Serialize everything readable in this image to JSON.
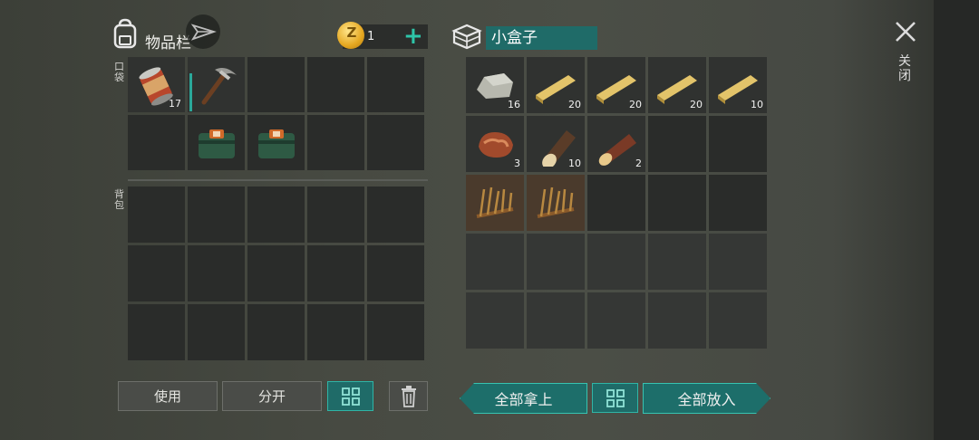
{
  "header": {
    "inventory_title": "物品栏",
    "coin_symbol": "Z",
    "coin_count": "1",
    "add_symbol": "+",
    "container_name": "小盒子",
    "close_label": "关闭"
  },
  "sections": {
    "pocket": "口袋",
    "backpack": "背包"
  },
  "pocket_slots": [
    {
      "item": "canned-food-icon",
      "count": "17"
    },
    {
      "item": "pickaxe-icon",
      "count": "",
      "durability": true
    },
    {
      "item": "",
      "count": ""
    },
    {
      "item": "",
      "count": ""
    },
    {
      "item": "",
      "count": ""
    },
    {
      "item": "",
      "count": ""
    },
    {
      "item": "medkit-icon",
      "count": ""
    },
    {
      "item": "medkit-icon",
      "count": ""
    },
    {
      "item": "",
      "count": ""
    },
    {
      "item": "",
      "count": ""
    }
  ],
  "box_slots": [
    {
      "item": "stone-icon",
      "count": "16"
    },
    {
      "item": "plank-icon",
      "count": "20"
    },
    {
      "item": "plank-icon",
      "count": "20"
    },
    {
      "item": "plank-icon",
      "count": "20"
    },
    {
      "item": "plank-icon",
      "count": "10"
    },
    {
      "item": "raw-meat-icon",
      "count": "3"
    },
    {
      "item": "birch-log-icon",
      "count": "10"
    },
    {
      "item": "pine-log-icon",
      "count": "2"
    },
    {
      "item": "",
      "count": ""
    },
    {
      "item": "",
      "count": ""
    },
    {
      "item": "spike-trap-icon",
      "count": ""
    },
    {
      "item": "spike-trap-icon",
      "count": ""
    }
  ],
  "buttons": {
    "use": "使用",
    "split": "分开",
    "take_all": "全部拿上",
    "put_all": "全部放入"
  },
  "colors": {
    "accent": "#1f6b68",
    "accent_border": "#2fb5a6",
    "slot": "#2a2c2a"
  }
}
